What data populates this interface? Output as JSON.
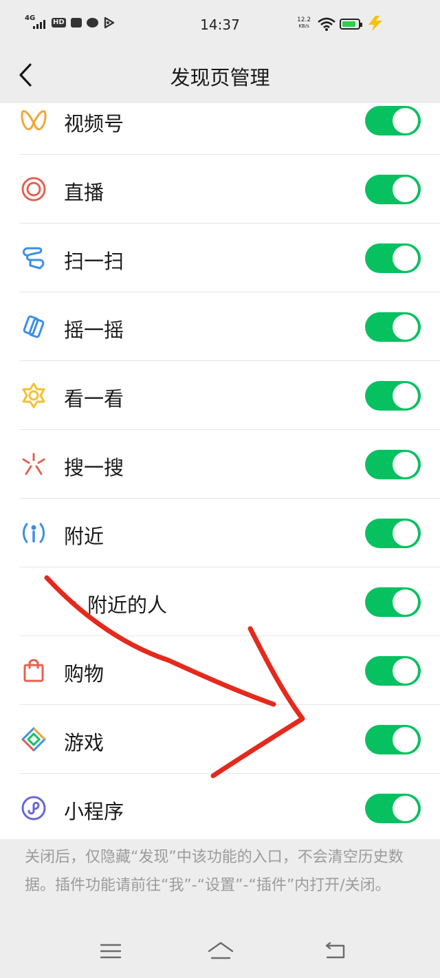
{
  "status_bar": {
    "time": "14:37",
    "network": "4G",
    "hd": "HD",
    "speed_top": "12.2",
    "speed_unit": "KB/s"
  },
  "header": {
    "title": "发现页管理",
    "back_icon": "chevron-left-icon"
  },
  "list": {
    "items": [
      {
        "label": "视频号",
        "icon": "channels-icon",
        "enabled": true
      },
      {
        "label": "直播",
        "icon": "live-icon",
        "enabled": true
      },
      {
        "label": "扫一扫",
        "icon": "scan-icon",
        "enabled": true
      },
      {
        "label": "摇一摇",
        "icon": "shake-icon",
        "enabled": true
      },
      {
        "label": "看一看",
        "icon": "top-stories-icon",
        "enabled": true
      },
      {
        "label": "搜一搜",
        "icon": "search-icon",
        "enabled": true
      },
      {
        "label": "附近",
        "icon": "nearby-icon",
        "enabled": true
      },
      {
        "label": "附近的人",
        "icon": "",
        "enabled": true,
        "sub": true
      },
      {
        "label": "购物",
        "icon": "shopping-bag-icon",
        "enabled": true
      },
      {
        "label": "游戏",
        "icon": "games-icon",
        "enabled": true
      },
      {
        "label": "小程序",
        "icon": "mini-programs-icon",
        "enabled": true
      }
    ]
  },
  "note": "关闭后，仅隐藏“发现”中该功能的入口，不会清空历史数据。插件功能请前往“我”-“设置”-“插件”内打开/关闭。",
  "navbar": {
    "menu_icon": "menu-icon",
    "home_icon": "home-icon",
    "back_icon": "back-icon"
  },
  "colors": {
    "toggle_on": "#07c160",
    "annotation": "#e5291d",
    "background": "#ededed"
  }
}
